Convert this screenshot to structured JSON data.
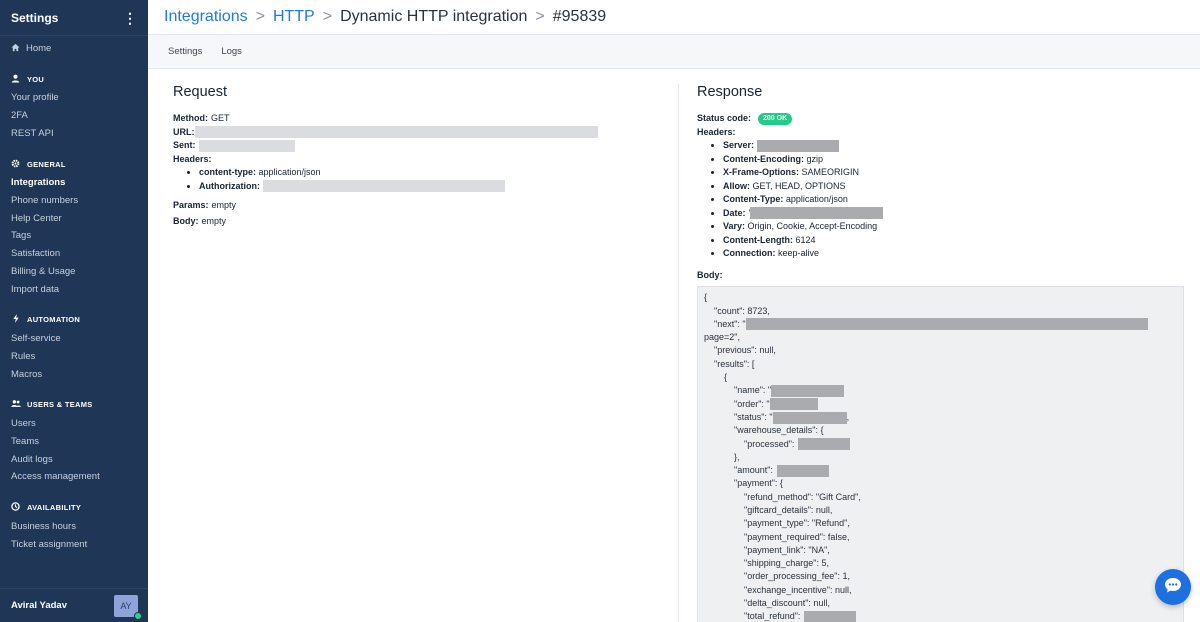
{
  "sidebar": {
    "title": "Settings",
    "menu_glyph": "⋮",
    "home": "Home",
    "sections": [
      {
        "title": "YOU",
        "icon": "user-icon",
        "items": [
          "Your profile",
          "2FA",
          "REST API"
        ]
      },
      {
        "title": "GENERAL",
        "icon": "gear-icon",
        "items": [
          "Integrations",
          "Phone numbers",
          "Help Center",
          "Tags",
          "Satisfaction",
          "Billing & Usage",
          "Import data"
        ]
      },
      {
        "title": "AUTOMATION",
        "icon": "bolt-icon",
        "items": [
          "Self-service",
          "Rules",
          "Macros"
        ]
      },
      {
        "title": "USERS & TEAMS",
        "icon": "users-icon",
        "items": [
          "Users",
          "Teams",
          "Audit logs",
          "Access management"
        ]
      },
      {
        "title": "AVAILABILITY",
        "icon": "clock-icon",
        "items": [
          "Business hours",
          "Ticket assignment"
        ]
      }
    ],
    "active_item": "Integrations",
    "user": {
      "name": "Aviral Yadav",
      "initials": "AY",
      "status_color": "#2bd18a"
    }
  },
  "breadcrumb": {
    "items": [
      "Integrations",
      "HTTP",
      "Dynamic HTTP integration",
      "#95839"
    ],
    "separator": ">"
  },
  "tabs": [
    "Settings",
    "Logs"
  ],
  "request": {
    "title": "Request",
    "method_label": "Method:",
    "method": "GET",
    "url_label": "URL:",
    "sent_label": "Sent:",
    "headers_label": "Headers:",
    "headers": [
      {
        "key": "content-type:",
        "value": "application/json"
      },
      {
        "key": "Authorization:",
        "value": ""
      }
    ],
    "params_label": "Params:",
    "params": "empty",
    "body_label": "Body:",
    "body": "empty"
  },
  "response": {
    "title": "Response",
    "status_label": "Status code:",
    "status": "200 OK",
    "headers_label": "Headers:",
    "headers": [
      {
        "key": "Server:",
        "value": ""
      },
      {
        "key": "Content-Encoding:",
        "value": "gzip"
      },
      {
        "key": "X-Frame-Options:",
        "value": "SAMEORIGIN"
      },
      {
        "key": "Allow:",
        "value": "GET, HEAD, OPTIONS"
      },
      {
        "key": "Content-Type:",
        "value": "application/json"
      },
      {
        "key": "Date:",
        "value": "'"
      },
      {
        "key": "Vary:",
        "value": "Origin, Cookie, Accept-Encoding"
      },
      {
        "key": "Content-Length:",
        "value": "6124"
      },
      {
        "key": "Connection:",
        "value": "keep-alive"
      }
    ],
    "body_label": "Body:",
    "body_lines": [
      "{",
      "\"count\": 8723,",
      "\"next\": \"",
      "page=2\",",
      "\"previous\": null,",
      "\"results\": [",
      "{",
      "\"name\": \"",
      "\"order\": \"",
      "\"status\": \"",
      "\"warehouse_details\": {",
      "\"processed\":",
      "},",
      "\"amount\":",
      "\"payment\": {",
      "\"refund_method\": \"Gift Card\",",
      "\"giftcard_details\": null,",
      "\"payment_type\": \"Refund\",",
      "\"payment_required\": false,",
      "\"payment_link\": \"NA\",",
      "\"shipping_charge\": 5,",
      "\"order_processing_fee\": 1,",
      "\"exchange_incentive\": null,",
      "\"delta_discount\": null,",
      "\"total_refund\":"
    ],
    "status_trailing": ","
  },
  "colors": {
    "sidebar_bg": "#1f3656",
    "link": "#1e7bdc",
    "badge": "#25c98a",
    "chat": "#1e6fe0"
  }
}
